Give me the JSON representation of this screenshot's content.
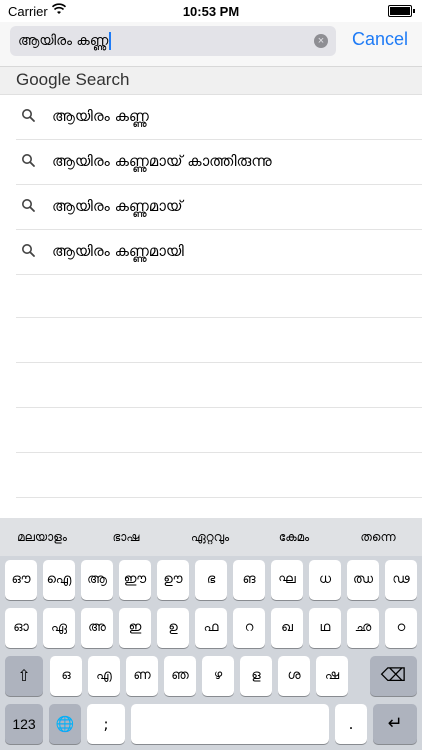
{
  "status": {
    "carrier": "Carrier",
    "time": "10:53 PM"
  },
  "search": {
    "query": "ആയിരം കണ്ണു",
    "clear_symbol": "×",
    "cancel_label": "Cancel"
  },
  "section_header": "Google Search",
  "results": [
    "ആയിരം കണ്ണു",
    "ആയിരം കണ്ണുമായ് കാത്തിരുന്നു",
    "ആയിരം കണ്ണുമായ്",
    "ആയിരം കണ്ണുമായി"
  ],
  "suggestions": [
    "മലയാളം",
    "ഭാഷ",
    "ഏറ്റവും",
    "കേമം",
    "തന്നെ"
  ],
  "keys": {
    "row1": [
      "ഔ",
      "ഐ",
      "ആ",
      "ഈ",
      "ഊ",
      "ഭ",
      "ങ",
      "ഘ",
      "ധ",
      "ഝ",
      "ഢ"
    ],
    "row2": [
      "ഓ",
      "ഏ",
      "അ",
      "ഇ",
      "ഉ",
      "ഫ",
      "റ",
      "ഖ",
      "ഥ",
      "ഛ",
      "ഠ"
    ],
    "row3": [
      "ഒ",
      "എ",
      "ണ",
      "ഞ",
      "ഴ",
      "ള",
      "ശ",
      "ഷ"
    ],
    "shift_symbol": "⇧",
    "backspace_symbol": "⌫",
    "numbers_label": "123",
    "globe_symbol": "🌐",
    "semicolon": ";",
    "space_label": "",
    "period": ".",
    "return_symbol": "↵"
  }
}
